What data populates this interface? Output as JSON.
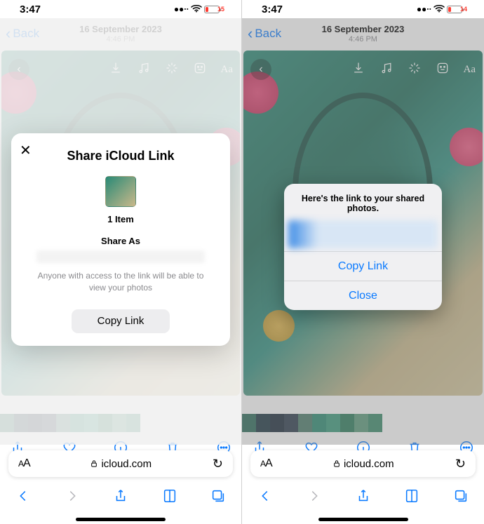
{
  "status": {
    "time": "3:47",
    "battery_pct": "15",
    "battery_pct_right": "14"
  },
  "nav": {
    "back": "Back",
    "date": "16 September 2023",
    "time": "4:46 PM"
  },
  "share_sheet": {
    "title": "Share iCloud Link",
    "item_count": "1 Item",
    "share_as_label": "Share As",
    "description": "Anyone with access to the link will be able to view your photos",
    "copy_btn": "Copy Link"
  },
  "alert": {
    "heading": "Here's the link to your shared photos.",
    "copy": "Copy Link",
    "close": "Close"
  },
  "safari": {
    "domain": "icloud.com"
  }
}
